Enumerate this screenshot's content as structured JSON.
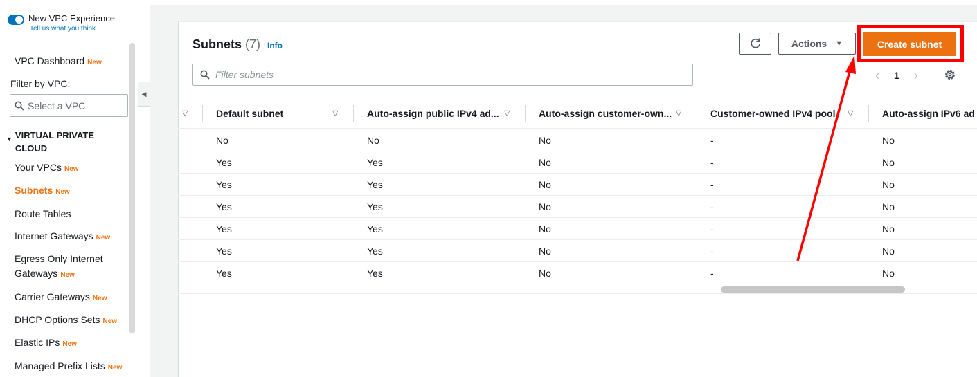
{
  "sidebar": {
    "experience_title": "New VPC Experience",
    "experience_link": "Tell us what you think",
    "new_badge": "New",
    "dashboard": "VPC Dashboard",
    "filter_label": "Filter by VPC:",
    "vpc_select_placeholder": "Select a VPC",
    "section": "VIRTUAL PRIVATE CLOUD",
    "items": [
      {
        "label": "Your VPCs",
        "badge": "New"
      },
      {
        "label": "Subnets",
        "badge": "New"
      },
      {
        "label": "Route Tables",
        "badge": ""
      },
      {
        "label": "Internet Gateways",
        "badge": "New"
      },
      {
        "label": "Egress Only Internet",
        "label2": "Gateways",
        "badge": "New"
      },
      {
        "label": "Carrier Gateways",
        "badge": "New"
      },
      {
        "label": "DHCP Options Sets",
        "badge": "New"
      },
      {
        "label": "Elastic IPs",
        "badge": "New"
      },
      {
        "label": "Managed Prefix Lists",
        "badge": "New"
      }
    ]
  },
  "panel": {
    "title": "Subnets",
    "count": "(7)",
    "info": "Info",
    "actions_label": "Actions",
    "create_label": "Create subnet",
    "filter_placeholder": "Filter subnets",
    "page": "1"
  },
  "table": {
    "columns": [
      "Default subnet",
      "Auto-assign public IPv4 ad...",
      "Auto-assign customer-own...",
      "Customer-owned IPv4 pool",
      "Auto-assign IPv6 ad"
    ],
    "rows": [
      [
        "No",
        "No",
        "No",
        "-",
        "No"
      ],
      [
        "Yes",
        "Yes",
        "No",
        "-",
        "No"
      ],
      [
        "Yes",
        "Yes",
        "No",
        "-",
        "No"
      ],
      [
        "Yes",
        "Yes",
        "No",
        "-",
        "No"
      ],
      [
        "Yes",
        "Yes",
        "No",
        "-",
        "No"
      ],
      [
        "Yes",
        "Yes",
        "No",
        "-",
        "No"
      ],
      [
        "Yes",
        "Yes",
        "No",
        "-",
        "No"
      ]
    ]
  },
  "colors": {
    "accent_orange": "#ec7211",
    "link_blue": "#0073bb",
    "annotation_red": "#ff0000"
  }
}
